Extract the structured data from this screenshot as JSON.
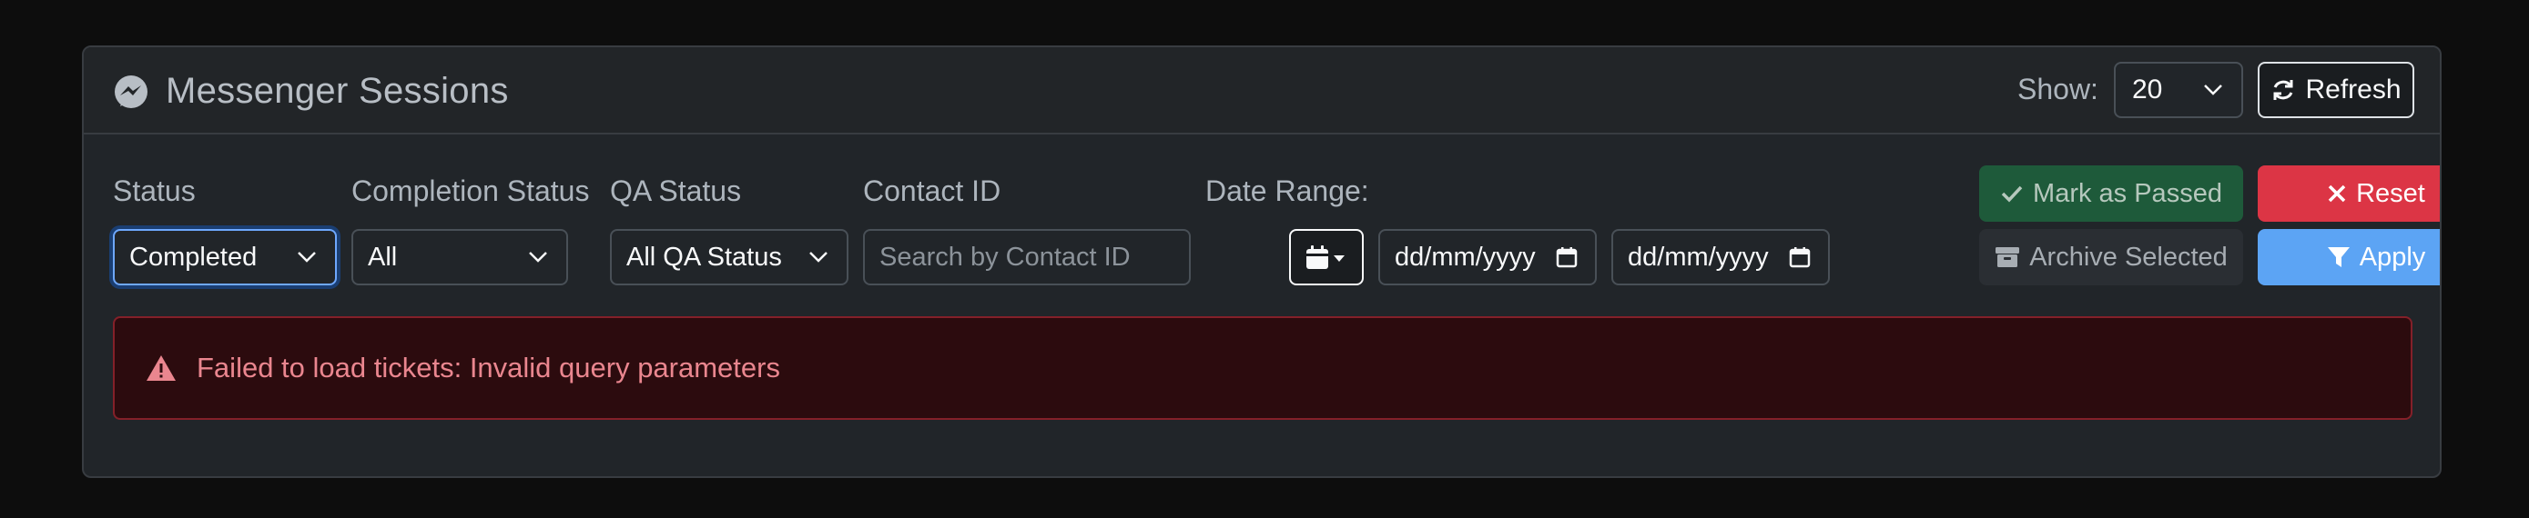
{
  "header": {
    "title": "Messenger Sessions",
    "show_label": "Show:",
    "page_size": "20",
    "refresh_label": "Refresh"
  },
  "filters": {
    "status": {
      "label": "Status",
      "value": "Completed"
    },
    "completion_status": {
      "label": "Completion Status",
      "value": "All"
    },
    "qa_status": {
      "label": "QA Status",
      "value": "All QA Status"
    },
    "contact_id": {
      "label": "Contact ID",
      "placeholder": "Search by Contact ID"
    },
    "date_range": {
      "label": "Date Range:",
      "from_placeholder": "dd/mm/yyyy",
      "to_placeholder": "dd/mm/yyyy"
    }
  },
  "actions": {
    "mark_passed": "Mark as Passed",
    "reset": "Reset",
    "archive": "Archive Selected",
    "apply": "Apply"
  },
  "alert": {
    "message": "Failed to load tickets: Invalid query parameters"
  },
  "colors": {
    "accent": "#6ea8fe",
    "success": "#1e5a3a",
    "danger": "#dc3545",
    "primary": "#5ca4f4",
    "alert_bg": "#2c0b0e",
    "alert_text": "#ea868f"
  },
  "icons": {
    "title": "messenger-icon",
    "refresh": "refresh-icon",
    "calendar": "calendar-icon",
    "check": "check-icon",
    "close": "close-icon",
    "archive": "archive-icon",
    "filter": "filter-icon",
    "warning": "warning-icon"
  }
}
